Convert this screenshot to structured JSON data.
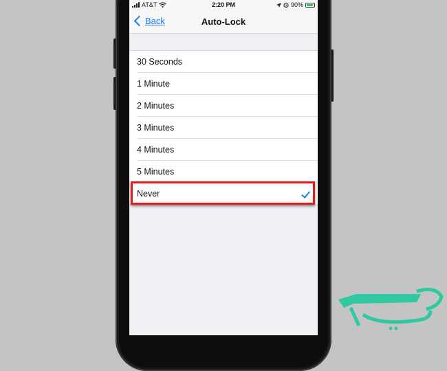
{
  "status_bar": {
    "carrier": "AT&T",
    "time": "2:20 PM",
    "battery_percent": "90%",
    "battery_level": 0.9
  },
  "nav": {
    "back_label": "Back",
    "title": "Auto-Lock"
  },
  "options": [
    {
      "label": "30 Seconds",
      "selected": false
    },
    {
      "label": "1 Minute",
      "selected": false
    },
    {
      "label": "2 Minutes",
      "selected": false
    },
    {
      "label": "3 Minutes",
      "selected": false
    },
    {
      "label": "4 Minutes",
      "selected": false
    },
    {
      "label": "5 Minutes",
      "selected": false
    },
    {
      "label": "Never",
      "selected": true
    }
  ],
  "colors": {
    "accent": "#1a7cf5",
    "highlight": "#e31d1d",
    "watermark": "#2fc8a0",
    "battery": "#31c454"
  },
  "watermark_logo_text": "مدیا"
}
